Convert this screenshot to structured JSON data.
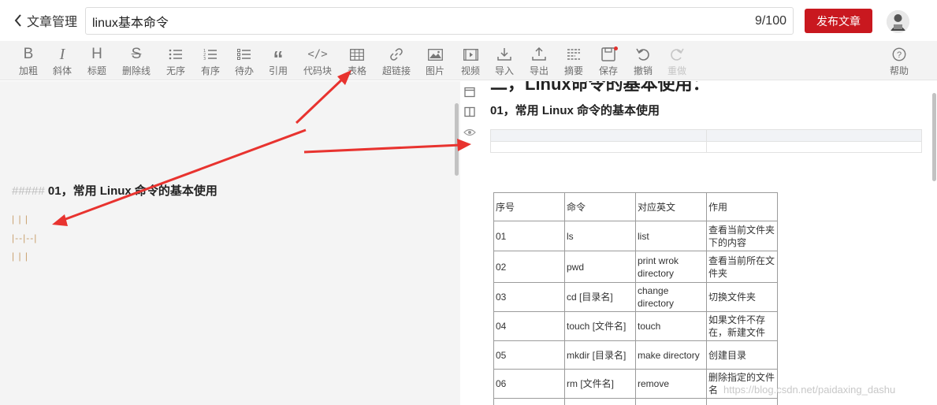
{
  "header": {
    "back_label": "文章管理",
    "title_value": "linux基本命令",
    "title_count": "9/100",
    "publish_label": "发布文章"
  },
  "toolbar": {
    "tools": [
      {
        "label": "加粗",
        "icon": "bold-icon"
      },
      {
        "label": "斜体",
        "icon": "italic-icon"
      },
      {
        "label": "标题",
        "icon": "heading-icon"
      },
      {
        "label": "删除线",
        "icon": "strikethrough-icon"
      },
      {
        "label": "无序",
        "icon": "unordered-list-icon"
      },
      {
        "label": "有序",
        "icon": "ordered-list-icon"
      },
      {
        "label": "待办",
        "icon": "todo-list-icon"
      },
      {
        "label": "引用",
        "icon": "quote-icon"
      },
      {
        "label": "代码块",
        "icon": "code-icon"
      },
      {
        "label": "表格",
        "icon": "table-icon"
      },
      {
        "label": "超链接",
        "icon": "link-icon"
      },
      {
        "label": "图片",
        "icon": "image-icon"
      },
      {
        "label": "视频",
        "icon": "video-icon"
      },
      {
        "label": "导入",
        "icon": "import-icon"
      },
      {
        "label": "导出",
        "icon": "export-icon"
      },
      {
        "label": "摘要",
        "icon": "summary-icon"
      },
      {
        "label": "保存",
        "icon": "save-icon"
      },
      {
        "label": "撤销",
        "icon": "undo-icon"
      },
      {
        "label": "重做",
        "icon": "redo-icon"
      },
      {
        "label": "帮助",
        "icon": "help-icon"
      }
    ]
  },
  "editor": {
    "heading_hashes": "#####",
    "heading_text": "01，常用 Linux 命令的基本使用",
    "line1": "| | |",
    "line2": "|--|--|",
    "line3": "| | |"
  },
  "preview": {
    "h2_cut": "二，Linux命令的基本使用：",
    "h5": "01，常用 Linux 命令的基本使用",
    "table": {
      "headers": [
        "序号",
        "命令",
        "对应英文",
        "作用"
      ],
      "rows": [
        [
          "01",
          "ls",
          "list",
          "查看当前文件夹下的内容"
        ],
        [
          "02",
          "pwd",
          "print wrok directory",
          "查看当前所在文件夹"
        ],
        [
          "03",
          "cd [目录名]",
          "change directory",
          "切换文件夹"
        ],
        [
          "04",
          "touch [文件名]",
          "touch",
          "如果文件不存在，新建文件"
        ],
        [
          "05",
          "mkdir [目录名]",
          "make directory",
          "创建目录"
        ],
        [
          "06",
          "rm [文件名]",
          "remove",
          "删除指定的文件名"
        ]
      ]
    }
  },
  "watermark": "https://blog.csdn.net/paidaxing_dashu",
  "colors": {
    "publish": "#c9181f",
    "arrow": "#e8332f",
    "editor_bg": "#f4f4f4",
    "toolbar_bg": "#f3f3f3"
  }
}
